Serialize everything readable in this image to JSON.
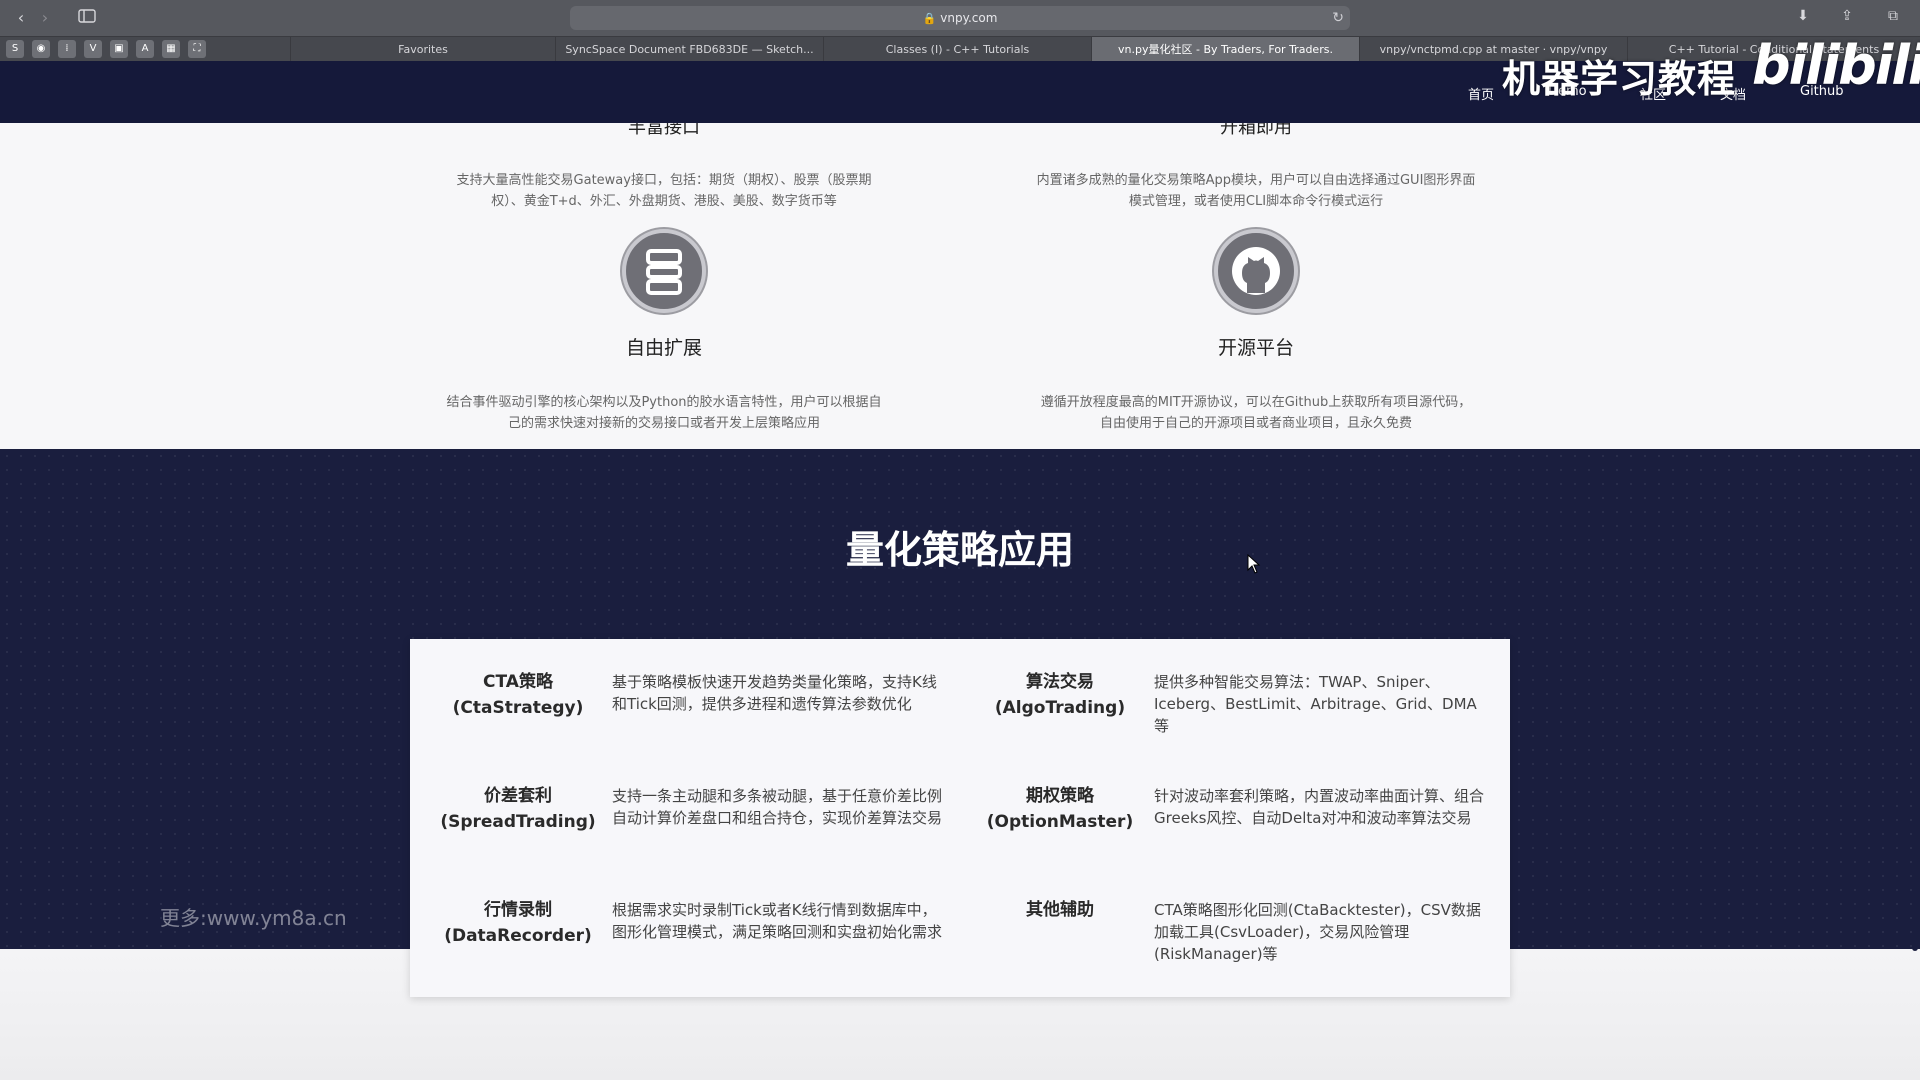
{
  "browser": {
    "url": "vnpy.com",
    "favorites_label": "Favorites",
    "tabs": [
      "SyncSpace Document FBD683DE — Sketch...",
      "Classes (I) - C++ Tutorials",
      "vn.py量化社区 - By Traders, For Traders.",
      "vnpy/vnctpmd.cpp at master · vnpy/vnpy",
      "C++ Tutorial - Conditional Statements"
    ]
  },
  "nav": {
    "links": [
      "首页",
      "Demo",
      "社区",
      "文档",
      "Github"
    ]
  },
  "overlay": {
    "course_title": "机器学习教程",
    "platform_logo": "bilibili",
    "site_watermark": "更多:www.ym8a.cn"
  },
  "features": {
    "top_left_title": "丰富接口",
    "top_left_desc": "支持大量高性能交易Gateway接口，包括：期货（期权）、股票（股票期权）、黄金T+d、外汇、外盘期货、港股、美股、数字货币等",
    "top_right_title": "开箱即用",
    "top_right_desc": "内置诸多成熟的量化交易策略App模块，用户可以自由选择通过GUI图形界面模式管理，或者使用CLI脚本命令行模式运行",
    "items": [
      {
        "title": "自由扩展",
        "desc": "结合事件驱动引擎的核心架构以及Python的胶水语言特性，用户可以根据自己的需求快速对接新的交易接口或者开发上层策略应用",
        "icon": "server-icon"
      },
      {
        "title": "开源平台",
        "desc": "遵循开放程度最高的MIT开源协议，可以在Github上获取所有项目源代码，自由使用于自己的开源项目或者商业项目，且永久免费",
        "icon": "github-icon"
      }
    ]
  },
  "apps": {
    "section_title": "量化策略应用",
    "items": [
      {
        "name": "CTA策略",
        "sub": "(CtaStrategy)",
        "desc": "基于策略模板快速开发趋势类量化策略，支持K线和Tick回测，提供多进程和遗传算法参数优化"
      },
      {
        "name": "算法交易",
        "sub": "(AlgoTrading)",
        "desc": "提供多种智能交易算法：TWAP、Sniper、Iceberg、BestLimit、Arbitrage、Grid、DMA等"
      },
      {
        "name": "价差套利",
        "sub": "(SpreadTrading)",
        "desc": "支持一条主动腿和多条被动腿，基于任意价差比例自动计算价差盘口和组合持仓，实现价差算法交易"
      },
      {
        "name": "期权策略",
        "sub": "(OptionMaster)",
        "desc": "针对波动率套利策略，内置波动率曲面计算、组合Greeks风控、自动Delta对冲和波动率算法交易"
      },
      {
        "name": "行情录制",
        "sub": "(DataRecorder)",
        "desc": "根据需求实时录制Tick或者K线行情到数据库中，图形化管理模式，满足策略回测和实盘初始化需求"
      },
      {
        "name": "其他辅助",
        "sub": "",
        "desc": "CTA策略图形化回测(CtaBacktester)，CSV数据加载工具(CsvLoader)，交易风险管理(RiskManager)等"
      }
    ]
  },
  "colors": {
    "navy": "#15193a",
    "dark_section": "#1a1e3e",
    "card_bg": "#f7f7fa"
  }
}
